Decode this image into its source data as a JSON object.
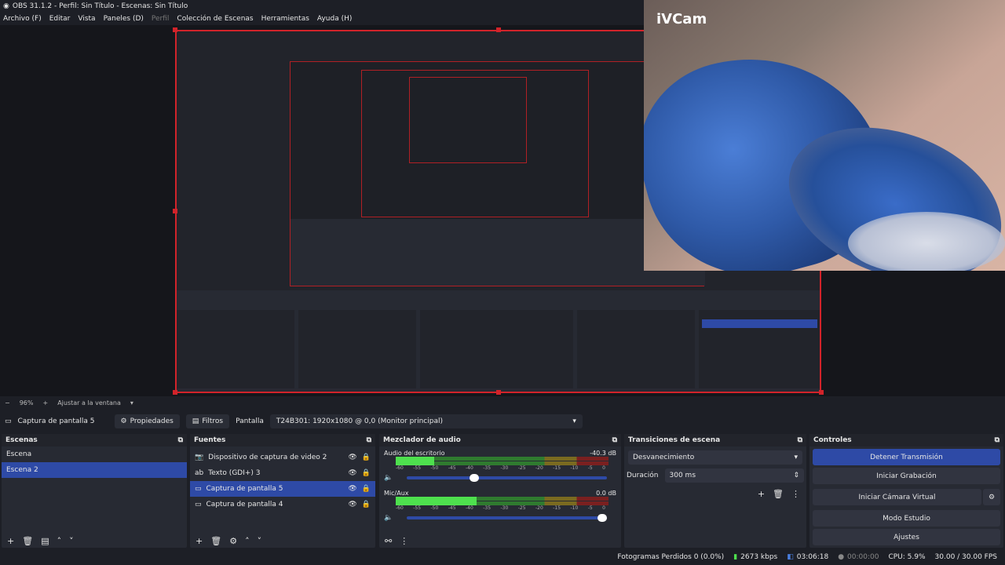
{
  "window": {
    "title": "OBS 31.1.2 - Perfil: Sin Título - Escenas: Sin Título"
  },
  "menu": [
    {
      "label": "Archivo (F)",
      "disabled": false
    },
    {
      "label": "Editar",
      "disabled": false
    },
    {
      "label": "Vista",
      "disabled": false
    },
    {
      "label": "Paneles (D)",
      "disabled": false
    },
    {
      "label": "Perfil",
      "disabled": true
    },
    {
      "label": "Colección de Escenas",
      "disabled": false
    },
    {
      "label": "Herramientas",
      "disabled": false
    },
    {
      "label": "Ayuda (H)",
      "disabled": false
    }
  ],
  "preview": {
    "ivcam_label": "iVCam"
  },
  "zoom": {
    "minus": "−",
    "value": "96%",
    "plus": "+",
    "fit_label": "Ajustar a la ventana"
  },
  "source_toolbar": {
    "source_name": "Captura de pantalla 5",
    "properties_label": "Propiedades",
    "filters_label": "Filtros",
    "display_label": "Pantalla",
    "display_value": "T24B301: 1920x1080 @ 0,0 (Monitor principal)"
  },
  "scenes": {
    "title": "Escenas",
    "items": [
      {
        "label": "Escena",
        "selected": false
      },
      {
        "label": "Escena 2",
        "selected": true
      }
    ]
  },
  "sources": {
    "title": "Fuentes",
    "items": [
      {
        "label": "Dispositivo de captura de video 2",
        "icon": "camera-icon",
        "selected": false
      },
      {
        "label": "Texto (GDI+) 3",
        "icon": "text-icon",
        "selected": false
      },
      {
        "label": "Captura de pantalla 5",
        "icon": "monitor-icon",
        "selected": true
      },
      {
        "label": "Captura de pantalla 4",
        "icon": "monitor-icon",
        "selected": false
      }
    ]
  },
  "mixer": {
    "title": "Mezclador de audio",
    "scale": [
      "-60",
      "-55",
      "-50",
      "-45",
      "-40",
      "-35",
      "-30",
      "-25",
      "-20",
      "-15",
      "-10",
      "-5",
      "0"
    ],
    "channels": [
      {
        "name": "Audio del escritorio",
        "db": "-40.3 dB",
        "level": 0.18,
        "volume": 0.36
      },
      {
        "name": "Mic/Aux",
        "db": "0.0 dB",
        "level": 0.38,
        "volume": 1.0
      }
    ]
  },
  "transitions": {
    "title": "Transiciones de escena",
    "selected": "Desvanecimiento",
    "duration_label": "Duración",
    "duration_value": "300 ms"
  },
  "controls": {
    "title": "Controles",
    "buttons": [
      {
        "label": "Detener Transmisión",
        "primary": true
      },
      {
        "label": "Iniciar Grabación",
        "primary": false
      },
      {
        "label": "Iniciar Cámara Virtual",
        "primary": false
      },
      {
        "label": "Modo Estudio",
        "primary": false
      },
      {
        "label": "Ajustes",
        "primary": false
      }
    ]
  },
  "status": {
    "dropped_frames": "Fotogramas Perdidos 0 (0.0%)",
    "bitrate": "2673 kbps",
    "stream_time": "03:06:18",
    "record_time": "00:00:00",
    "cpu": "CPU: 5.9%",
    "fps": "30.00 / 30.00 FPS"
  },
  "colors": {
    "accent": "#2e4aa6",
    "record_border": "#d2232a",
    "background": "#1d1f26"
  }
}
